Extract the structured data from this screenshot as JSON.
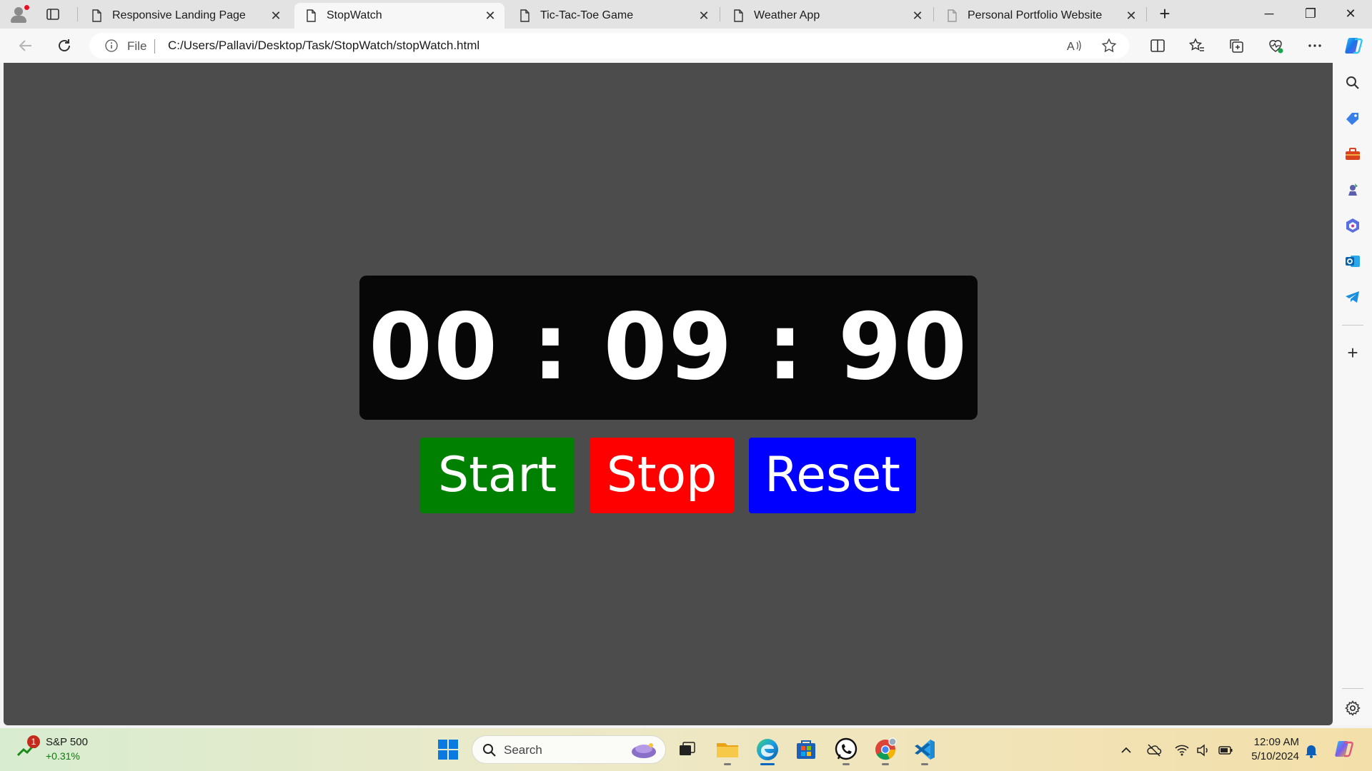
{
  "browser": {
    "tabs": [
      {
        "title": "Responsive Landing Page"
      },
      {
        "title": "StopWatch"
      },
      {
        "title": "Tic-Tac-Toe Game"
      },
      {
        "title": "Weather App"
      },
      {
        "title": "Personal Portfolio Website"
      }
    ],
    "active_tab_index": 1,
    "close_glyph": "✕",
    "new_tab_glyph": "+",
    "window_controls": {
      "minimize": "─",
      "maximize": "❐",
      "close": "✕"
    },
    "address": {
      "scheme_label": "File",
      "url": "C:/Users/Pallavi/Desktop/Task/StopWatch/stopWatch.html"
    }
  },
  "stopwatch": {
    "display": "00 : 09 : 90",
    "buttons": {
      "start": "Start",
      "stop": "Stop",
      "reset": "Reset"
    },
    "colors": {
      "page_bg": "#4c4c4c",
      "display_bg": "#070707",
      "start": "#008000",
      "stop": "#ff0000",
      "reset": "#0000ff"
    }
  },
  "sidebar": {
    "icons": [
      "search-icon",
      "tag-icon",
      "toolbox-icon",
      "games-icon",
      "microsoft365-icon",
      "outlook-icon",
      "telegram-icon"
    ],
    "add_glyph": "+"
  },
  "taskbar": {
    "widget": {
      "badge": "1",
      "name": "S&P 500",
      "value": "+0.31%"
    },
    "search_placeholder": "Search",
    "apps": [
      "windows-start-icon",
      "task-view-icon",
      "file-explorer-icon",
      "edge-icon",
      "microsoft-store-icon",
      "whatsapp-icon",
      "chrome-icon",
      "vscode-icon"
    ],
    "clock": {
      "time": "12:09 AM",
      "date": "5/10/2024"
    }
  }
}
